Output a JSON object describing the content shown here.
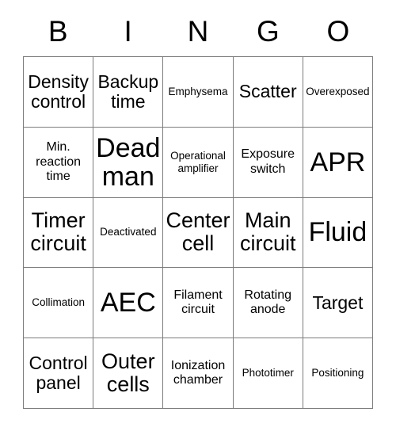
{
  "card": {
    "title": "BINGO",
    "header_letters": [
      "B",
      "I",
      "N",
      "G",
      "O"
    ],
    "grid_color": "#7c7c7c",
    "text_color": "#000000",
    "background": "#ffffff",
    "rows": [
      [
        {
          "text": "Density control",
          "size": "md"
        },
        {
          "text": "Backup time",
          "size": "md"
        },
        {
          "text": "Emphysema",
          "size": "xs"
        },
        {
          "text": "Scatter",
          "size": "md"
        },
        {
          "text": "Overexposed",
          "size": "xs"
        }
      ],
      [
        {
          "text": "Min. reaction time",
          "size": "sm"
        },
        {
          "text": "Dead man",
          "size": "xl"
        },
        {
          "text": "Operational amplifier",
          "size": "xs"
        },
        {
          "text": "Exposure switch",
          "size": "sm"
        },
        {
          "text": "APR",
          "size": "xl"
        }
      ],
      [
        {
          "text": "Timer circuit",
          "size": "lg"
        },
        {
          "text": "Deactivated",
          "size": "xs"
        },
        {
          "text": "Center cell",
          "size": "lg"
        },
        {
          "text": "Main circuit",
          "size": "lg"
        },
        {
          "text": "Fluid",
          "size": "xl"
        }
      ],
      [
        {
          "text": "Collimation",
          "size": "xs"
        },
        {
          "text": "AEC",
          "size": "xl"
        },
        {
          "text": "Filament circuit",
          "size": "sm"
        },
        {
          "text": "Rotating anode",
          "size": "sm"
        },
        {
          "text": "Target",
          "size": "md"
        }
      ],
      [
        {
          "text": "Control panel",
          "size": "md"
        },
        {
          "text": "Outer cells",
          "size": "lg"
        },
        {
          "text": "Ionization chamber",
          "size": "sm"
        },
        {
          "text": "Phototimer",
          "size": "xs"
        },
        {
          "text": "Positioning",
          "size": "xs"
        }
      ]
    ]
  }
}
